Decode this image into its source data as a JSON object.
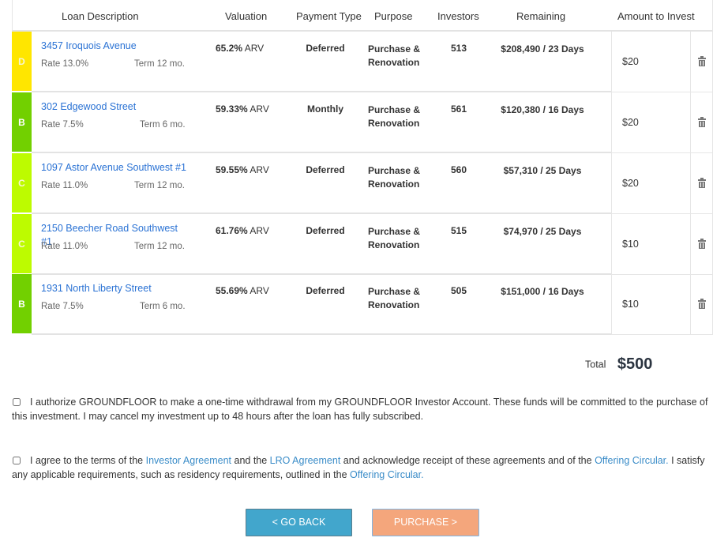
{
  "table": {
    "headers": {
      "loan_description": "Loan Description",
      "valuation": "Valuation",
      "payment_type": "Payment Type",
      "purpose": "Purpose",
      "investors": "Investors",
      "remaining": "Remaining",
      "amount_to_invest": "Amount to Invest"
    },
    "grade_colors": {
      "B": "#72d000",
      "C": "#bdfb00",
      "D": "#ffe600"
    },
    "rows": [
      {
        "grade": "D",
        "address": "3457 Iroquois Avenue",
        "rate": "Rate 13.0%",
        "term": "Term 12 mo.",
        "valuation_pct": "65.2%",
        "valuation_suffix": "ARV",
        "payment_type": "Deferred",
        "purpose_line1": "Purchase &",
        "purpose_line2": "Renovation",
        "investors": "513",
        "remaining": "$208,490 / 23 Days",
        "amount": "$20"
      },
      {
        "grade": "B",
        "address": "302 Edgewood Street",
        "rate": "Rate 7.5%",
        "term": "Term 6 mo.",
        "valuation_pct": "59.33%",
        "valuation_suffix": "ARV",
        "payment_type": "Monthly",
        "purpose_line1": "Purchase &",
        "purpose_line2": "Renovation",
        "investors": "561",
        "remaining": "$120,380 / 16 Days",
        "amount": "$20"
      },
      {
        "grade": "C",
        "address": "1097 Astor Avenue Southwest #1",
        "rate": "Rate 11.0%",
        "term": "Term 12 mo.",
        "valuation_pct": "59.55%",
        "valuation_suffix": "ARV",
        "payment_type": "Deferred",
        "purpose_line1": "Purchase &",
        "purpose_line2": "Renovation",
        "investors": "560",
        "remaining": "$57,310 / 25 Days",
        "amount": "$20"
      },
      {
        "grade": "C",
        "address": "2150 Beecher Road Southwest #1",
        "rate": "Rate 11.0%",
        "term": "Term 12 mo.",
        "valuation_pct": "61.76%",
        "valuation_suffix": "ARV",
        "payment_type": "Deferred",
        "purpose_line1": "Purchase &",
        "purpose_line2": "Renovation",
        "investors": "515",
        "remaining": "$74,970 / 25 Days",
        "amount": "$10"
      },
      {
        "grade": "B",
        "address": "1931 North Liberty Street",
        "rate": "Rate 7.5%",
        "term": "Term 6 mo.",
        "valuation_pct": "55.69%",
        "valuation_suffix": "ARV",
        "payment_type": "Deferred",
        "purpose_line1": "Purchase &",
        "purpose_line2": "Renovation",
        "investors": "505",
        "remaining": "$151,000 / 16 Days",
        "amount": "$10"
      }
    ],
    "delete_icon": "trash-icon"
  },
  "total": {
    "label": "Total",
    "value": "$500"
  },
  "agreements": {
    "withdrawal": {
      "checked": false,
      "text": "I authorize GROUNDFLOOR to make a one-time withdrawal from my GROUNDFLOOR Investor Account. These funds will be committed to the purchase of this investment. I may cancel my investment up to 48 hours after the loan has fully subscribed."
    },
    "terms": {
      "checked": false,
      "part1": "I agree to the terms of the ",
      "link1": "Investor Agreement",
      "part2": " and the ",
      "link2": "LRO Agreement",
      "part3": " and acknowledge receipt of these agreements and of the ",
      "link3": "Offering Circular.",
      "part4": " I satisfy any applicable requirements, such as residency requirements, outlined in the ",
      "link4": "Offering Circular."
    }
  },
  "buttons": {
    "go_back": "< GO BACK",
    "purchase": "PURCHASE >"
  },
  "colors": {
    "link": "#2a72d4",
    "go_back_bg": "#42a6cc",
    "purchase_bg": "#f4a67c"
  }
}
